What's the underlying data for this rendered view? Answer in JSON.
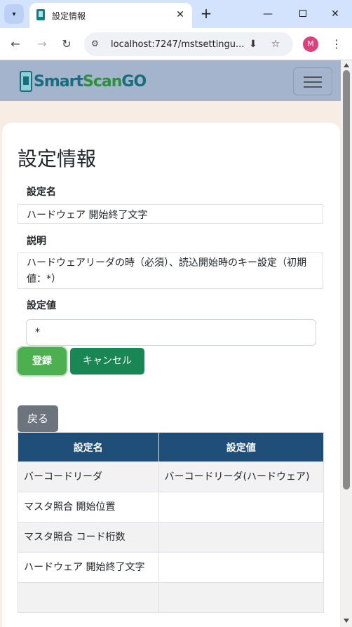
{
  "browser": {
    "tab_title": "設定情報",
    "url": "localhost:7247/mstsettingu...",
    "profile_initial": "M",
    "icons": [
      "tab-list-icon",
      "favicon",
      "close-icon",
      "plus-icon",
      "minimize-icon",
      "maximize-icon",
      "window-close-icon",
      "back-arrow-icon",
      "forward-arrow-icon",
      "reload-icon",
      "site-info-icon",
      "install-icon",
      "star-icon",
      "kebab-menu-icon"
    ]
  },
  "app": {
    "logo": {
      "smart": "Smart",
      "scan": "Scan",
      "go": "GO"
    }
  },
  "page": {
    "title": "設定情報",
    "fields": {
      "name_label": "設定名",
      "name_value": "ハードウェア 開始終了文字",
      "desc_label": "説明",
      "desc_value": "ハードウェアリーダの時（必須）、読込開始時のキー設定（初期値：*）",
      "value_label": "設定値",
      "value_input": "*"
    },
    "buttons": {
      "register": "登録",
      "cancel": "キャンセル",
      "back": "戻る"
    },
    "table": {
      "headers": [
        "設定名",
        "設定値"
      ],
      "rows": [
        [
          "バーコードリーダ",
          "バーコードリーダ(ハードウェア)"
        ],
        [
          "マスタ照合 開始位置",
          ""
        ],
        [
          "マスタ照合 コード桁数",
          ""
        ],
        [
          "ハードウェア 開始終了文字",
          ""
        ]
      ]
    }
  },
  "colors": {
    "nav_bg": "#a3b4cc",
    "table_header": "#1f4e79",
    "register_btn": "#4caf50",
    "cancel_btn": "#198754",
    "back_btn": "#6c757d"
  }
}
